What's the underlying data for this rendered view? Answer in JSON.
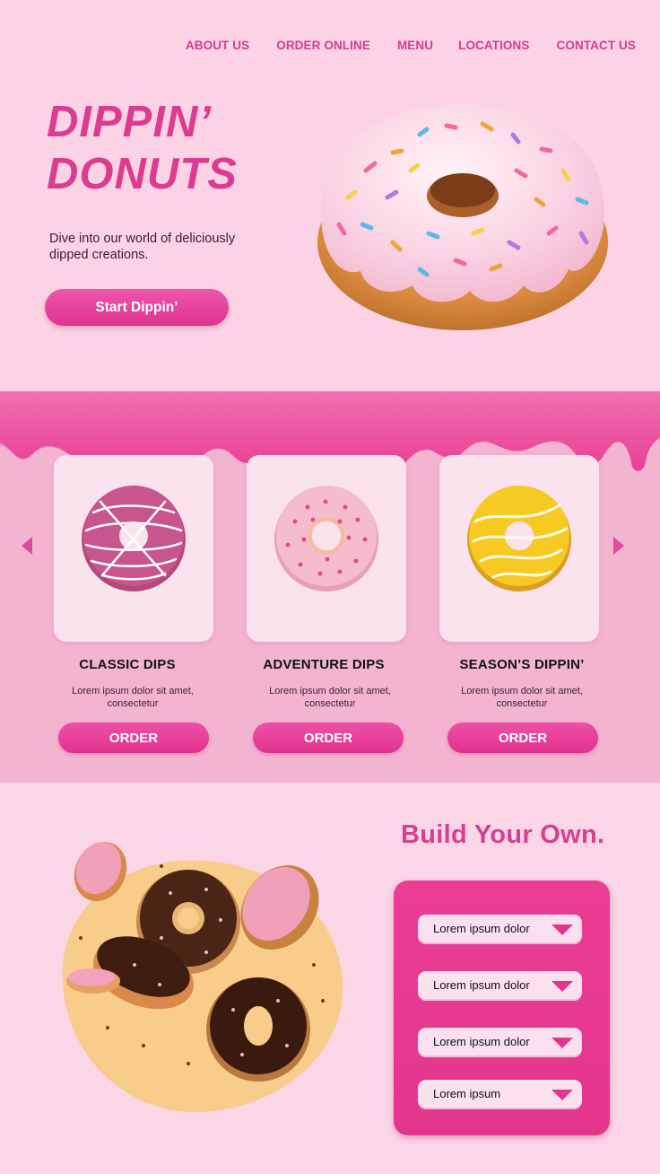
{
  "nav": {
    "items": [
      "ABOUT US",
      "ORDER ONLINE",
      "MENU",
      "LOCATIONS",
      "CONTACT US"
    ]
  },
  "hero": {
    "title_line1": "DIPPIN’",
    "title_line2": "DONUTS",
    "tagline": "Dive into our world of deliciously dipped creations.",
    "cta_label": "Start Dippin’"
  },
  "products": {
    "items": [
      {
        "title": "CLASSIC DIPS",
        "description": "Lorem ipsum dolor sit amet, consectetur",
        "order_label": "ORDER"
      },
      {
        "title": "ADVENTURE DIPS",
        "description": "Lorem ipsum dolor sit amet, consectetur",
        "order_label": "ORDER"
      },
      {
        "title": "SEASON’S DIPPIN’",
        "description": "Lorem ipsum dolor sit amet, consectetur",
        "order_label": "ORDER"
      }
    ]
  },
  "build": {
    "title": "Build Your Own.",
    "options": [
      "Lorem ipsum dolor",
      "Lorem ipsum dolor",
      "Lorem ipsum dolor",
      "Lorem ipsum"
    ]
  },
  "colors": {
    "accent": "#e3358c",
    "heading_pink": "#dc3c90",
    "hero_bg": "#fbd3e4",
    "section_bg": "#f3b4d0",
    "card_bg": "#fbe3ee",
    "bun_yellow": "#f8cc8a"
  },
  "icons": [
    "chevron-left-icon",
    "chevron-right-icon",
    "dropdown-arrow-icon"
  ]
}
